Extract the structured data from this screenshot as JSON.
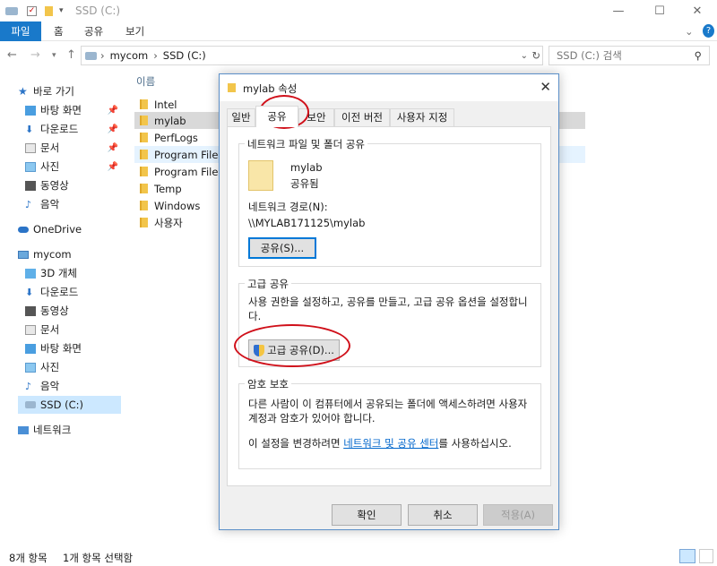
{
  "window": {
    "title": "SSD (C:)",
    "minimize": "—",
    "maximize": "☐",
    "close": "✕"
  },
  "ribbon": {
    "tabs": [
      "파일",
      "홈",
      "공유",
      "보기"
    ],
    "help": "?"
  },
  "address": {
    "path_root": "mycom",
    "path_drive": "SSD (C:)",
    "search_placeholder": "SSD (C:) 검색"
  },
  "nav": {
    "quick_access": "바로 가기",
    "quick_items": [
      "바탕 화면",
      "다운로드",
      "문서",
      "사진",
      "동영상",
      "음악"
    ],
    "onedrive": "OneDrive",
    "mycom": "mycom",
    "mycom_items": [
      "3D 개체",
      "다운로드",
      "동영상",
      "문서",
      "바탕 화면",
      "사진",
      "음악",
      "SSD (C:)"
    ],
    "network": "네트워크"
  },
  "files": {
    "column_name": "이름",
    "items": [
      "Intel",
      "mylab",
      "PerfLogs",
      "Program Files",
      "Program Files (",
      "Temp",
      "Windows",
      "사용자"
    ]
  },
  "status": {
    "count": "8개 항목",
    "selected": "1개 항목 선택함"
  },
  "dialog": {
    "title": "mylab 속성",
    "close": "✕",
    "tabs": [
      "일반",
      "공유",
      "보안",
      "이전 버전",
      "사용자 지정"
    ],
    "net_group": "네트워크 파일 및 폴더 공유",
    "folder_name": "mylab",
    "folder_state": "공유됨",
    "net_path_label": "네트워크 경로(N):",
    "net_path": "\\\\MYLAB171125\\mylab",
    "share_button": "공유(S)...",
    "adv_group": "고급 공유",
    "adv_desc": "사용 권한을 설정하고, 공유를 만들고, 고급 공유 옵션을 설정합니다.",
    "adv_button": "고급 공유(D)...",
    "pw_group": "암호 보호",
    "pw_desc": "다른 사람이 이 컴퓨터에서 공유되는 폴더에 액세스하려면 사용자 계정과 암호가 있어야 합니다.",
    "pw_change_prefix": "이 설정을 변경하려면 ",
    "pw_link": "네트워크 및 공유 센터",
    "pw_change_suffix": "를 사용하십시오.",
    "ok": "확인",
    "cancel": "취소",
    "apply": "적용(A)"
  },
  "colors": {
    "accent": "#1979ca",
    "highlight_circle": "#d0101a",
    "link": "#0066cc"
  }
}
